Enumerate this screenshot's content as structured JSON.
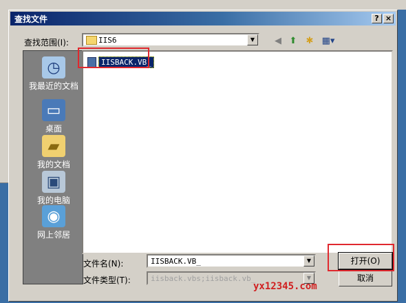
{
  "window": {
    "title": "查找文件",
    "help_glyph": "?",
    "close_glyph": "×"
  },
  "lookin": {
    "label": "查找范围(I):",
    "value": "IIS6",
    "folder_icon": "folder-icon"
  },
  "toolbar": {
    "back_icon": "back-icon",
    "up_icon": "up-folder-icon",
    "new_folder_icon": "new-folder-icon",
    "view_icon": "view-menu-icon"
  },
  "places": [
    {
      "label": "我最近的文档",
      "icon": "recent-documents-icon"
    },
    {
      "label": "桌面",
      "icon": "desktop-icon"
    },
    {
      "label": "我的文档",
      "icon": "my-documents-icon"
    },
    {
      "label": "我的电脑",
      "icon": "my-computer-icon"
    },
    {
      "label": "网上邻居",
      "icon": "network-icon"
    }
  ],
  "files": [
    {
      "name": "IISBACK.VB_",
      "icon": "file-icon",
      "selected": true
    }
  ],
  "filename": {
    "label": "文件名(N):",
    "value": "IISBACK.VB_"
  },
  "filetype": {
    "label": "文件类型(T):",
    "value": "iisback.vbs;iisback.vb_"
  },
  "buttons": {
    "open": "打开(O)",
    "cancel": "取消"
  },
  "watermark": "yx12345.com",
  "colors": {
    "titlebar": "#0a246a",
    "highlight_box": "#e0282e",
    "selection": "#0a246a"
  }
}
